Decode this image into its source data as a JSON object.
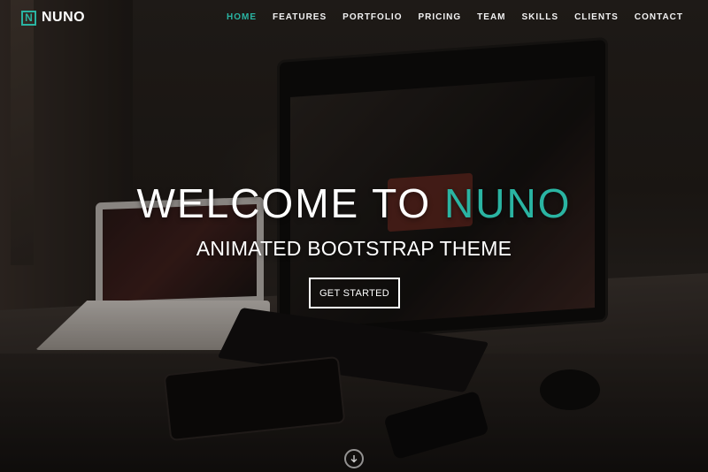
{
  "brand": {
    "icon_letter": "N",
    "name": "NUNO"
  },
  "nav": {
    "items": [
      {
        "label": "HOME",
        "active": true
      },
      {
        "label": "FEATURES",
        "active": false
      },
      {
        "label": "PORTFOLIO",
        "active": false
      },
      {
        "label": "PRICING",
        "active": false
      },
      {
        "label": "TEAM",
        "active": false
      },
      {
        "label": "SKILLS",
        "active": false
      },
      {
        "label": "CLIENTS",
        "active": false
      },
      {
        "label": "CONTACT",
        "active": false
      }
    ]
  },
  "hero": {
    "headline_prefix": "WELCOME TO ",
    "headline_accent": "NUNO",
    "subheadline": "ANIMATED BOOTSTRAP THEME",
    "cta_label": "GET STARTED",
    "scroll_icon": "arrow-down-circle-icon"
  },
  "colors": {
    "accent": "#2ab4a2",
    "text": "#ffffff"
  }
}
